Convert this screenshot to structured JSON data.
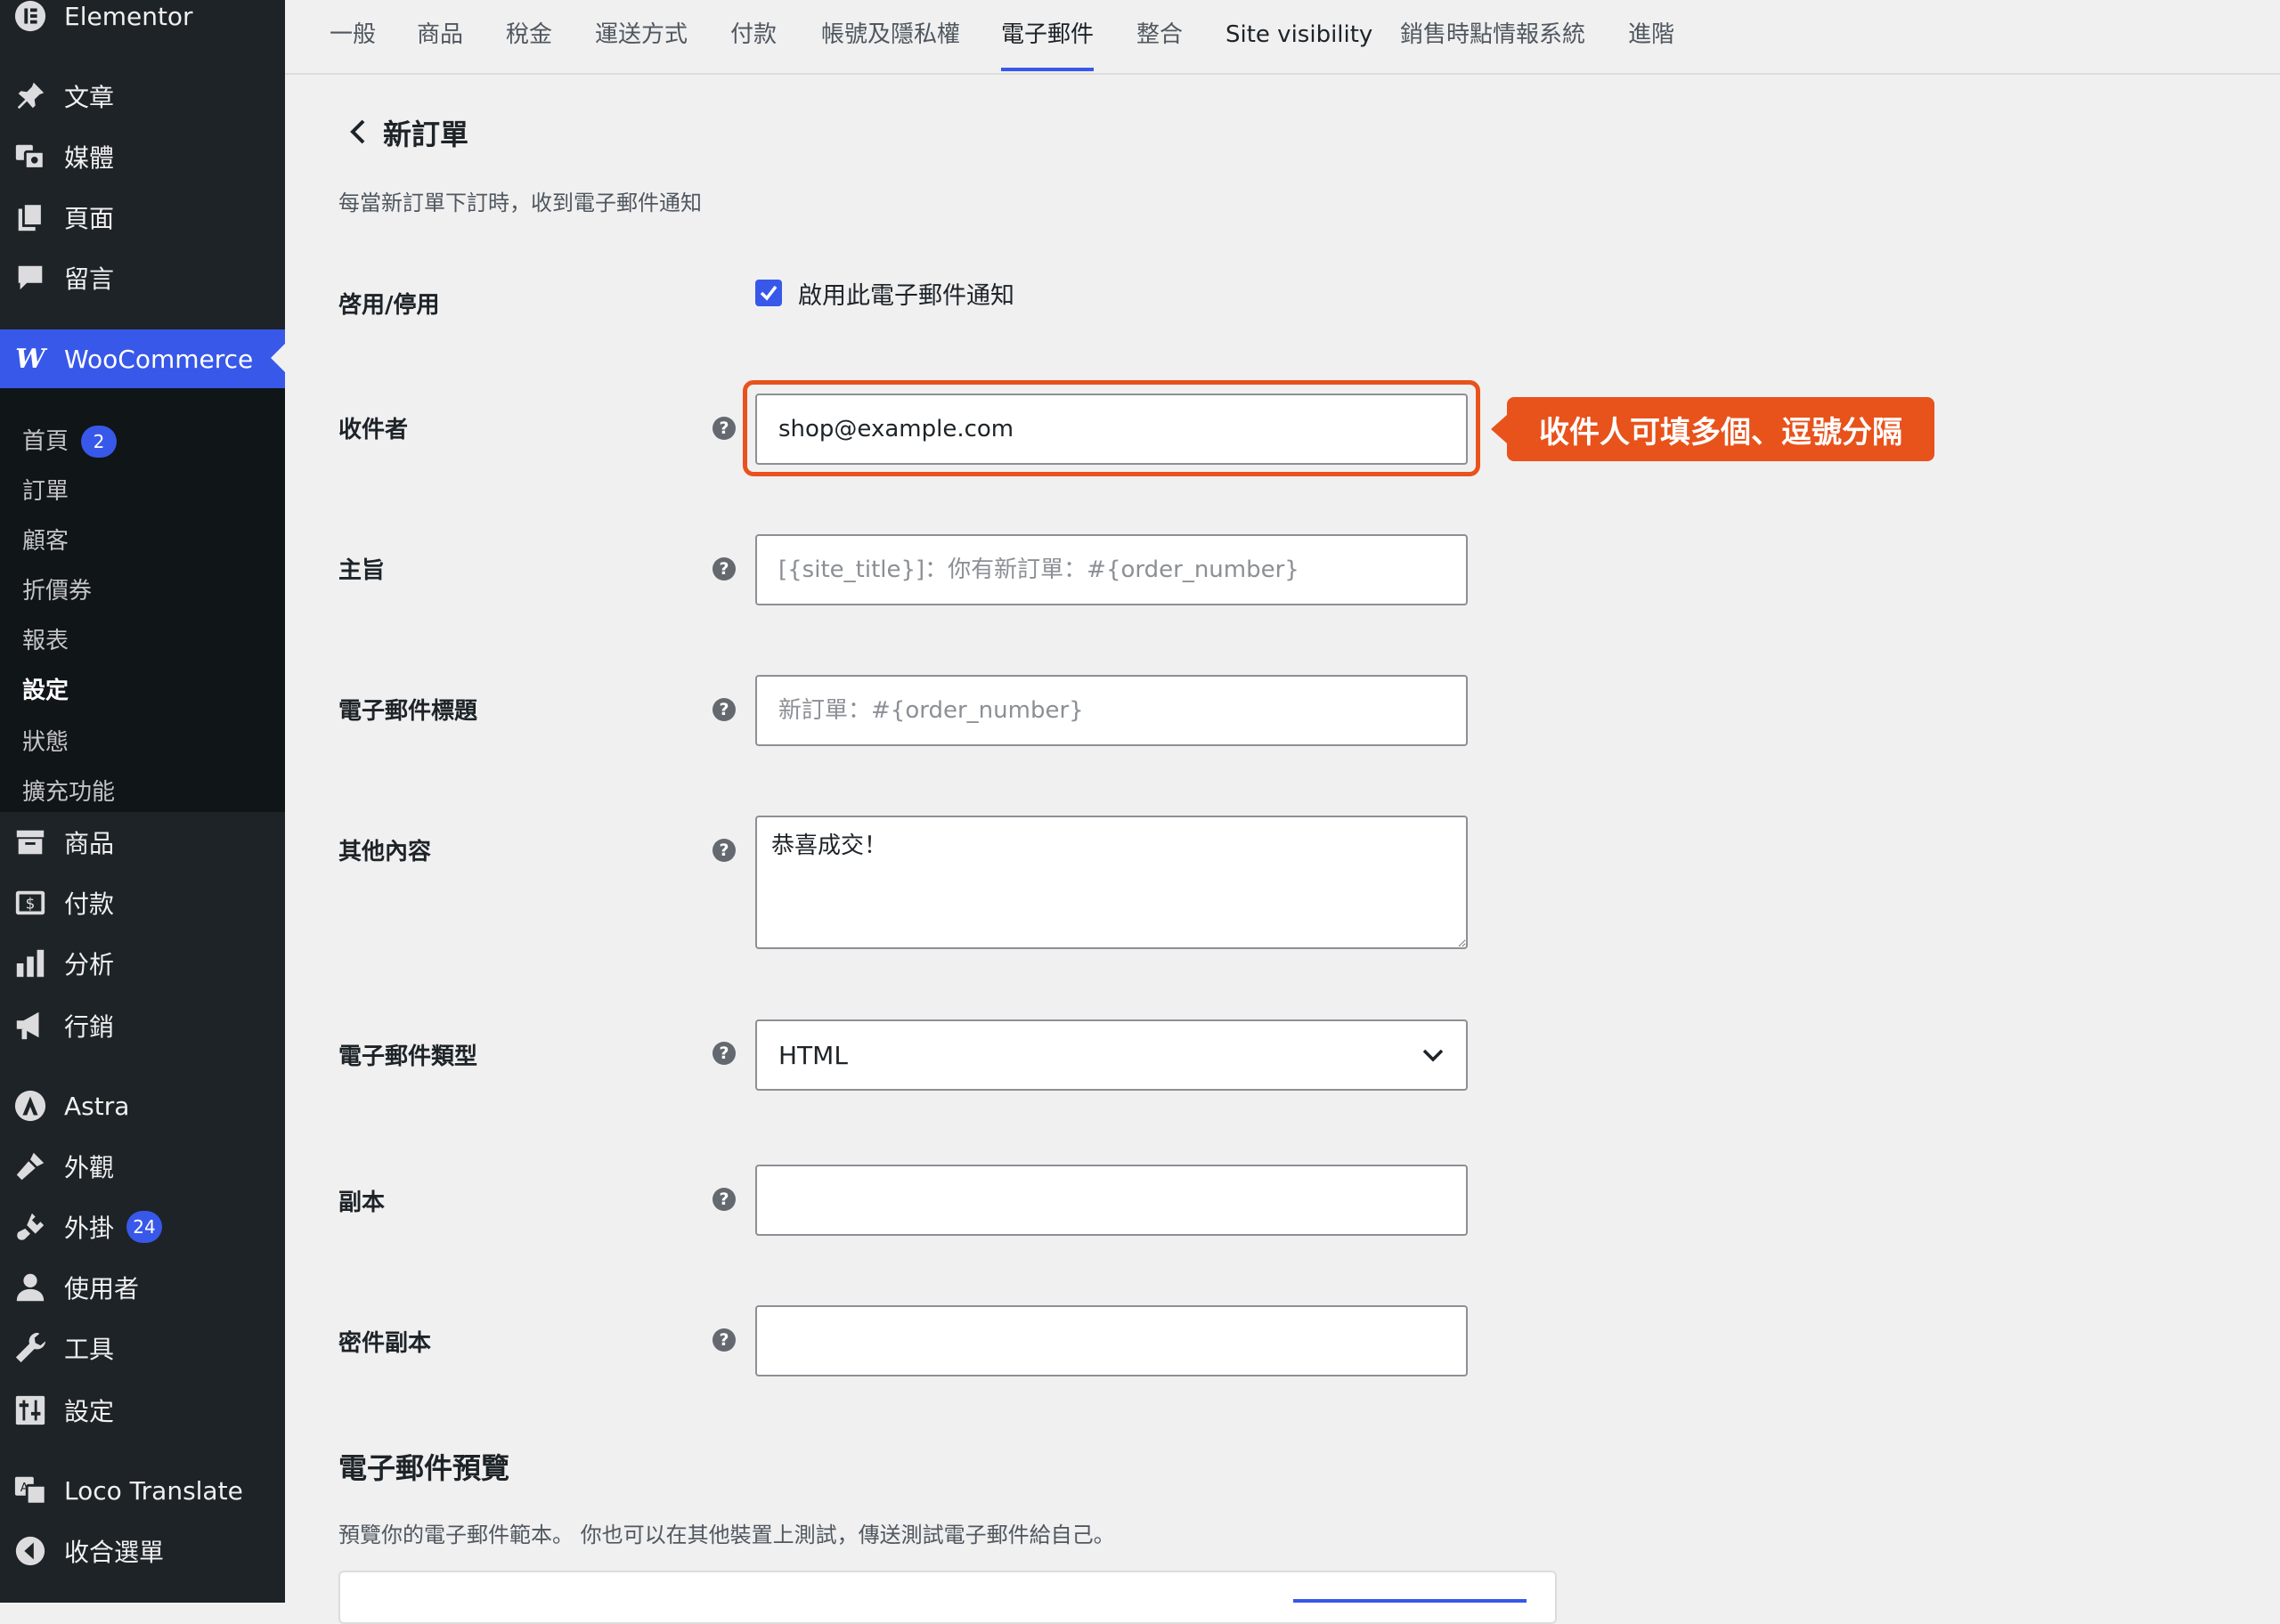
{
  "sidebar": {
    "top_item": "Elementor",
    "items": [
      {
        "label": "文章",
        "icon": "pin-icon"
      },
      {
        "label": "媒體",
        "icon": "media-icon"
      },
      {
        "label": "頁面",
        "icon": "pages-icon"
      },
      {
        "label": "留言",
        "icon": "comments-icon"
      },
      {
        "label": "WooCommerce",
        "icon": "woocommerce-icon"
      }
    ],
    "submenu": [
      {
        "label": "首頁",
        "badge": "2"
      },
      {
        "label": "訂單"
      },
      {
        "label": "顧客"
      },
      {
        "label": "折價券"
      },
      {
        "label": "報表"
      },
      {
        "label": "設定"
      },
      {
        "label": "狀態"
      },
      {
        "label": "擴充功能"
      }
    ],
    "items2": [
      {
        "label": "商品",
        "icon": "products-icon"
      },
      {
        "label": "付款",
        "icon": "payments-icon"
      },
      {
        "label": "分析",
        "icon": "analytics-icon"
      },
      {
        "label": "行銷",
        "icon": "marketing-icon"
      },
      {
        "label": "Astra",
        "icon": "astra-icon"
      },
      {
        "label": "外觀",
        "icon": "appearance-icon"
      },
      {
        "label": "外掛",
        "icon": "plugins-icon",
        "badge": "24"
      },
      {
        "label": "使用者",
        "icon": "users-icon"
      },
      {
        "label": "工具",
        "icon": "tools-icon"
      },
      {
        "label": "設定",
        "icon": "settings-icon"
      },
      {
        "label": "Loco Translate",
        "icon": "translate-icon"
      },
      {
        "label": "收合選單",
        "icon": "collapse-icon"
      }
    ]
  },
  "tabs": [
    "一般",
    "商品",
    "稅金",
    "運送方式",
    "付款",
    "帳號及隱私權",
    "電子郵件",
    "整合",
    "Site visibility",
    "銷售時點情報系統",
    "進階"
  ],
  "page": {
    "title": "新訂單",
    "description": "每當新訂單下訂時，收到電子郵件通知"
  },
  "form": {
    "enable_label": "啓用/停用",
    "enable_checkbox_label": "啟用此電子郵件通知",
    "recipient_label": "收件者",
    "recipient_value": "shop@example.com",
    "subject_label": "主旨",
    "subject_placeholder": "[{site_title}]：你有新訂單：#{order_number}",
    "heading_label": "電子郵件標題",
    "heading_placeholder": "新訂單：#{order_number}",
    "additional_label": "其他內容",
    "additional_value": "恭喜成交！",
    "type_label": "電子郵件類型",
    "type_value": "HTML",
    "cc_label": "副本",
    "bcc_label": "密件副本"
  },
  "callout": "收件人可填多個、逗號分隔",
  "preview": {
    "title": "電子郵件預覽",
    "description": "預覽你的電子郵件範本。 你也可以在其他裝置上測試，傳送測試電子郵件給自己。"
  },
  "colors": {
    "accent": "#3858e9",
    "callout": "#e8521b",
    "sidebar": "#1d2327"
  }
}
